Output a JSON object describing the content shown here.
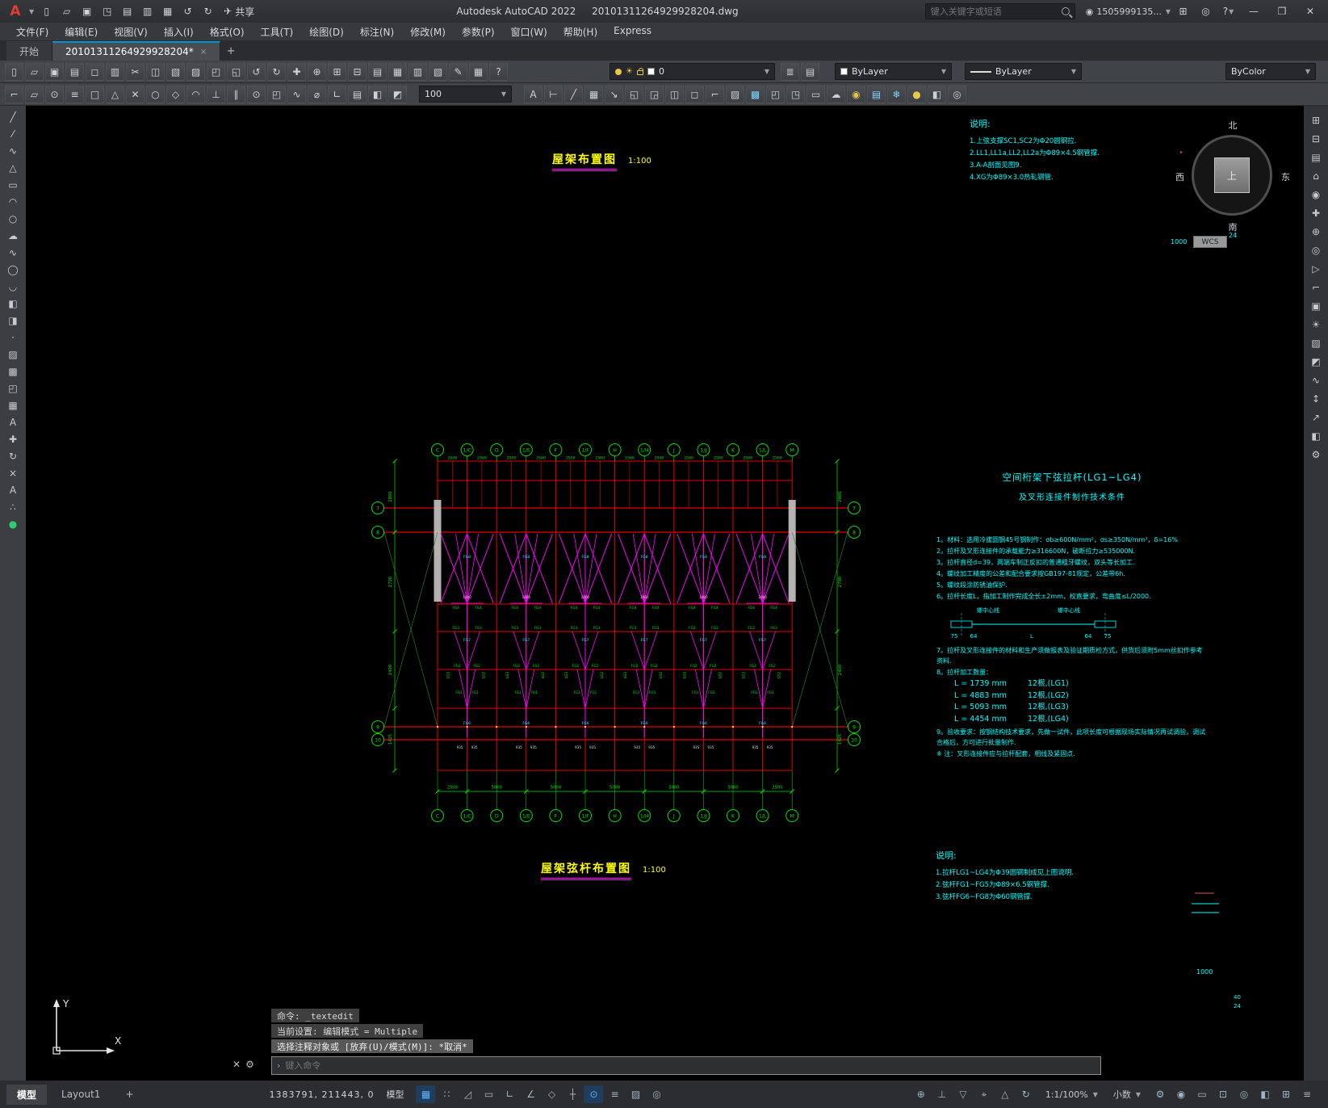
{
  "window": {
    "logo_letter": "A",
    "quick_access": [
      {
        "n": "qnew",
        "g": "▯"
      },
      {
        "n": "open",
        "g": "▱"
      },
      {
        "n": "save",
        "g": "▣"
      },
      {
        "n": "save-as",
        "g": "◳"
      },
      {
        "n": "open-from-web",
        "g": "▤"
      },
      {
        "n": "save-to-web",
        "g": "▥"
      },
      {
        "n": "plot",
        "g": "▦"
      },
      {
        "n": "undo",
        "g": "↺"
      },
      {
        "n": "redo",
        "g": "↻"
      }
    ],
    "share_label": "共享",
    "share_icon": "✈",
    "title_app": "Autodesk AutoCAD 2022",
    "title_doc": "20101311264929928204.dwg",
    "search_placeholder": "键入关键字或短语",
    "user_name": "1505999135...",
    "help_label": "?",
    "min_glyph": "—",
    "max_glyph": "❐",
    "close_glyph": "✕"
  },
  "menubar": {
    "items": [
      "文件(F)",
      "编辑(E)",
      "视图(V)",
      "插入(I)",
      "格式(O)",
      "工具(T)",
      "绘图(D)",
      "标注(N)",
      "修改(M)",
      "参数(P)",
      "窗口(W)",
      "帮助(H)",
      "Express"
    ]
  },
  "tabs": {
    "start_label": "开始",
    "doc_label": "20101311264929928204*",
    "close_glyph": "×",
    "plus_glyph": "+"
  },
  "toolbar1": {
    "icons": [
      {
        "n": "qnew",
        "g": "▯"
      },
      {
        "n": "open",
        "g": "▱"
      },
      {
        "n": "save",
        "g": "▣"
      },
      {
        "n": "plot",
        "g": "▤"
      },
      {
        "n": "plot-preview",
        "g": "◻"
      },
      {
        "n": "publish",
        "g": "▥"
      },
      {
        "n": "cut",
        "g": "✂"
      },
      {
        "n": "copy",
        "g": "◫"
      },
      {
        "n": "paste",
        "g": "▧"
      },
      {
        "n": "match-properties",
        "g": "▨"
      },
      {
        "n": "block-editor",
        "g": "◰"
      },
      {
        "n": "xref",
        "g": "◱"
      },
      {
        "n": "undo",
        "g": "↺"
      },
      {
        "n": "redo",
        "g": "↻"
      },
      {
        "n": "pan",
        "g": "✚"
      },
      {
        "n": "zoom-realtime",
        "g": "⊕"
      },
      {
        "n": "zoom-window",
        "g": "⊞"
      },
      {
        "n": "zoom-previous",
        "g": "⊟"
      },
      {
        "n": "properties",
        "g": "▤"
      },
      {
        "n": "designcenter",
        "g": "▦"
      },
      {
        "n": "tool-palettes",
        "g": "▥"
      },
      {
        "n": "sheet-set-manager",
        "g": "▧"
      },
      {
        "n": "markup-set-manager",
        "g": "✎"
      },
      {
        "n": "quickcalc",
        "g": "▦"
      },
      {
        "n": "help",
        "g": "?"
      }
    ],
    "layer_group_icons": [
      {
        "n": "layer-properties",
        "g": "≣"
      },
      {
        "n": "layer-states",
        "g": "▤"
      }
    ],
    "layer_value": "0",
    "color_value": "ByLayer",
    "linetype_value": "ByLayer",
    "plotstyle_value": "ByColor"
  },
  "toolbar2": {
    "icons_a": [
      {
        "n": "dist",
        "g": "⌐"
      },
      {
        "n": "area",
        "g": "▱"
      },
      {
        "n": "id-point",
        "g": "⊙"
      },
      {
        "n": "list",
        "g": "≡"
      },
      {
        "n": "osnap-endpoint",
        "g": "□"
      },
      {
        "n": "osnap-midpoint",
        "g": "△"
      },
      {
        "n": "osnap-intersection",
        "g": "✕"
      },
      {
        "n": "osnap-center",
        "g": "○"
      },
      {
        "n": "osnap-quadrant",
        "g": "◇"
      },
      {
        "n": "osnap-tangent",
        "g": "◠"
      },
      {
        "n": "osnap-perpendicular",
        "g": "⊥"
      },
      {
        "n": "osnap-parallel",
        "g": "∥"
      },
      {
        "n": "osnap-node",
        "g": "⊙"
      },
      {
        "n": "osnap-insert",
        "g": "◰"
      },
      {
        "n": "osnap-nearest",
        "g": "∿"
      },
      {
        "n": "osnap-none",
        "g": "⌀"
      },
      {
        "n": "ucs",
        "g": "∟"
      },
      {
        "n": "named-ucs",
        "g": "▤"
      },
      {
        "n": "view",
        "g": "◧"
      },
      {
        "n": "3d-views",
        "g": "◩"
      }
    ],
    "size_value": "100",
    "icons_b": [
      {
        "n": "text-style",
        "g": "A"
      },
      {
        "n": "dim-linear",
        "g": "⊢"
      },
      {
        "n": "dim-aligned",
        "g": "╱"
      },
      {
        "n": "table",
        "g": "▦"
      },
      {
        "n": "mleader",
        "g": "↘"
      },
      {
        "n": "draw-order-front",
        "g": "◱"
      },
      {
        "n": "draw-order-back",
        "g": "◲"
      },
      {
        "n": "group",
        "g": "◫"
      },
      {
        "n": "ungroup",
        "g": "◻"
      },
      {
        "n": "measure",
        "g": "⌐"
      },
      {
        "n": "hatch",
        "g": "▨"
      },
      {
        "n": "gradient",
        "g": "▩",
        "c": "#7fd4ff"
      },
      {
        "n": "boundary",
        "g": "◰"
      },
      {
        "n": "region",
        "g": "◳"
      },
      {
        "n": "wipeout",
        "g": "▭"
      },
      {
        "n": "revision-cloud",
        "g": "☁"
      },
      {
        "n": "make-current-layer",
        "g": "◉",
        "c": "#e8c84a"
      },
      {
        "n": "layer-walk",
        "g": "▤",
        "c": "#7fd4ff"
      },
      {
        "n": "layer-freeze",
        "g": "❄",
        "c": "#7fd4ff"
      },
      {
        "n": "layer-off",
        "g": "●",
        "c": "#e8c84a"
      },
      {
        "n": "layer-lock",
        "g": "◧"
      },
      {
        "n": "layer-iso",
        "g": "◎"
      }
    ]
  },
  "left_toolbar": {
    "icons": [
      {
        "n": "line",
        "g": "╱"
      },
      {
        "n": "construction-line",
        "g": "⁄"
      },
      {
        "n": "polyline",
        "g": "∿"
      },
      {
        "n": "polygon",
        "g": "△"
      },
      {
        "n": "rectangle",
        "g": "▭"
      },
      {
        "n": "arc",
        "g": "◠"
      },
      {
        "n": "circle",
        "g": "○"
      },
      {
        "n": "revision-cloud",
        "g": "☁"
      },
      {
        "n": "spline",
        "g": "∿"
      },
      {
        "n": "ellipse",
        "g": "◯"
      },
      {
        "n": "ellipse-arc",
        "g": "◡"
      },
      {
        "n": "insert-block",
        "g": "◧"
      },
      {
        "n": "make-block",
        "g": "◨"
      },
      {
        "n": "point",
        "g": "·"
      },
      {
        "n": "hatch",
        "g": "▨"
      },
      {
        "n": "gradient",
        "g": "▩"
      },
      {
        "n": "region",
        "g": "◰"
      },
      {
        "n": "table",
        "g": "▦"
      },
      {
        "n": "multiline-text",
        "g": "A"
      },
      {
        "n": "move",
        "g": "✚"
      },
      {
        "n": "rotate",
        "g": "↻"
      },
      {
        "n": "erase",
        "g": "×"
      },
      {
        "n": "text",
        "g": "A"
      },
      {
        "n": "point-style",
        "g": "∴"
      },
      {
        "n": "color-dot",
        "g": "●",
        "c": "#2ecc71"
      }
    ]
  },
  "right_toolbar": {
    "icons": [
      {
        "n": "viewport-grid",
        "g": "⊞"
      },
      {
        "n": "viewport-single",
        "g": "⊟"
      },
      {
        "n": "named-views",
        "g": "▤"
      },
      {
        "n": "home",
        "g": "⌂"
      },
      {
        "n": "steering-wheel",
        "g": "◉"
      },
      {
        "n": "pan",
        "g": "✚"
      },
      {
        "n": "zoom-extents",
        "g": "⊕"
      },
      {
        "n": "orbit",
        "g": "◎"
      },
      {
        "n": "show-motion",
        "g": "▷"
      },
      {
        "n": "section",
        "g": "⌐"
      },
      {
        "n": "camera",
        "g": "▣"
      },
      {
        "n": "lights",
        "g": "☀"
      },
      {
        "n": "materials",
        "g": "▨"
      },
      {
        "n": "render",
        "g": "◩"
      },
      {
        "n": "motion-path",
        "g": "∿"
      },
      {
        "n": "walk",
        "g": "↕"
      },
      {
        "n": "fly",
        "g": "↗"
      },
      {
        "n": "visual-style",
        "g": "◧"
      },
      {
        "n": "settings",
        "g": "⚙"
      }
    ]
  },
  "drawing": {
    "title_top": "屋架布置图",
    "scale_top": "1:100",
    "title_bottom": "屋架弦杆布置图",
    "scale_bottom": "1:100",
    "axes": [
      "C",
      "1/C",
      "D",
      "1/E",
      "F",
      "1/F",
      "H",
      "1/H",
      "J",
      "1/J",
      "K",
      "1/L",
      "M"
    ],
    "row_marks": [
      "7",
      "8",
      "9",
      "10"
    ],
    "dim_top": "2500",
    "dims_bottom": [
      "2500",
      "5000",
      "5000",
      "5000",
      "5000",
      "5000",
      "2500"
    ],
    "dims_left": [
      "2800",
      "2700",
      "2400",
      "1425"
    ],
    "module_labels": {
      "top": "FG8",
      "chord": "FG4",
      "mid1": "FG3",
      "center": "FG7",
      "mid2": "FG2",
      "mid3": "FG1",
      "bottom": "FG6",
      "tie_l": "LG3",
      "tie_r": "LG2",
      "num": "1000",
      "base": "935"
    },
    "margin": {
      "top_num": "1000",
      "wcs": "WCS",
      "r1": "40",
      "r2": "24",
      "bottom_num": "1000"
    }
  },
  "viewcube": {
    "north": "北",
    "south": "南",
    "west": "西",
    "east": "东",
    "top": "上"
  },
  "notes_top": {
    "title": "说明:",
    "items": [
      "1.上弦支撑SC1,SC2为Φ20圆钢拉.",
      "2.LL1,LL1a,LL2,LL2a为Φ89×4.5钢管撑.",
      "3.A-A剖面见图9.",
      "4.XG为Φ89×3.0热轧钢管."
    ]
  },
  "tech": {
    "title1": "空间桁架下弦拉杆(LG1~LG4)",
    "title2": "及叉形连接件制作技术条件",
    "items": [
      "1。材料：选用冷拔圆钢45号钢制作：σb≥600N/mm²，σs≥350N/mm²，δ=16%",
      "2。拉杆及叉形连接件的承载能力≥316600N，破断拉力≥535000N.",
      "3。拉杆直径d=39，两端车制正反扣的普通粗牙螺纹，双头等长加工.",
      "4。螺纹加工精度的公差和配合要求按GB197-81规定，公差带6h.",
      "5。螺纹段涂防锈油保护.",
      "6。拉杆长度L，指加工制作完成全长±2mm，校直要求，弯曲度≤L/2000."
    ],
    "diagram": {
      "label_left": "螺中心线",
      "label_right": "螺中心线",
      "dims": [
        "75",
        "64",
        "L",
        "64",
        "75"
      ]
    },
    "items2": [
      "7。拉杆及叉形连接件的材料和生产须做报表及验证期质检方式，供货后须附5mm丝扣作参考资料.",
      "8。拉杆加工数量："
    ],
    "lengths": [
      "L = 1739  mm",
      "L = 4883  mm",
      "L = 5093  mm",
      "L = 4454  mm"
    ],
    "length_counts": [
      "12根,(LG1)",
      "12根,(LG2)",
      "12根,(LG3)",
      "12根,(LG4)"
    ],
    "items3": [
      "9。验收要求：按钢结构技术要求，先做一试件，此项长度可根据现场实际情况再试调验，调试合格后，方可进行批量制作.",
      "※ 注：叉形连接件应与拉杆配套，相线及紧固点."
    ]
  },
  "notes_bottom": {
    "title": "说明:",
    "items": [
      "1.拉杆LG1~LG4为Φ39圆钢制成见上图说明.",
      "2.弦杆FG1~FG5为Φ89×6.5钢管撑.",
      "3.弦杆FG6~FG8为Φ60钢管撑."
    ]
  },
  "command": {
    "tool_close": "✕",
    "tool_customize": "⚙",
    "line1": "命令: _textedit",
    "line2": "当前设置: 编辑模式 = Multiple",
    "line3": "选择注释对象或 [放弃(U)/模式(M)]: *取消*",
    "prompt": "›",
    "placeholder": "键入命令"
  },
  "statusbar": {
    "model_tab": "模型",
    "layout_tab": "Layout1",
    "plus": "+",
    "coords": "1383791, 211443, 0",
    "model_label": "模型",
    "icons_a": [
      {
        "n": "grid",
        "g": "▦",
        "on": true
      },
      {
        "n": "snap-mode",
        "g": "∷"
      },
      {
        "n": "infer-constraints",
        "g": "◿"
      },
      {
        "n": "dynamic-input",
        "g": "▭"
      },
      {
        "n": "ortho",
        "g": "∟"
      },
      {
        "n": "polar-tracking",
        "g": "∠"
      },
      {
        "n": "isodraft",
        "g": "◇"
      },
      {
        "n": "object-snap-tracking",
        "g": "┼"
      },
      {
        "n": "object-snap",
        "g": "⊙",
        "on": true
      },
      {
        "n": "lineweight",
        "g": "≡"
      },
      {
        "n": "transparency",
        "g": "▨"
      },
      {
        "n": "selection-cycling",
        "g": "◎"
      }
    ],
    "icons_b": [
      {
        "n": "3d-object-snap",
        "g": "⊕"
      },
      {
        "n": "dynamic-ucs",
        "g": "⊥"
      },
      {
        "n": "selection-filter",
        "g": "▽"
      },
      {
        "n": "gizmo",
        "g": "⌖"
      },
      {
        "n": "annotation-visibility",
        "g": "△"
      },
      {
        "n": "auto-scale",
        "g": "↻"
      }
    ],
    "scale": "1:1/100%",
    "units": "小数",
    "icons_c": [
      {
        "n": "workspace-switching",
        "g": "⚙"
      },
      {
        "n": "annotation-monitor",
        "g": "◉"
      },
      {
        "n": "quick-properties",
        "g": "▭"
      },
      {
        "n": "lock-ui",
        "g": "⊡"
      },
      {
        "n": "isolate-objects",
        "g": "◎"
      },
      {
        "n": "graphics-performance",
        "g": "◧"
      },
      {
        "n": "clean-screen",
        "g": "⊞"
      },
      {
        "n": "customize",
        "g": "≡"
      }
    ]
  }
}
